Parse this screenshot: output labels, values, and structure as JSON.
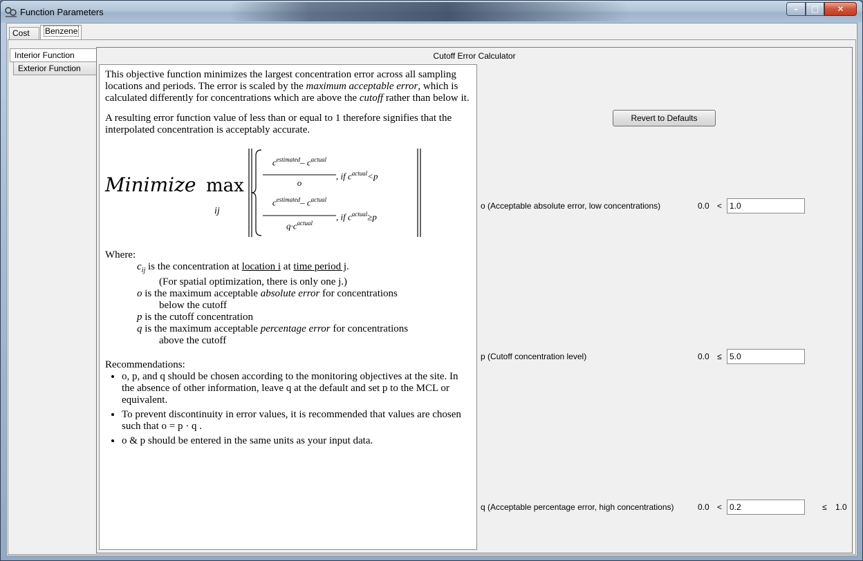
{
  "window": {
    "title": "Function Parameters"
  },
  "outer_tabs": {
    "cost": "Cost",
    "benzene": "Benzene"
  },
  "side_tabs": {
    "interior": "Interior Function",
    "exterior": "Exterior Function"
  },
  "panel": {
    "title": "Cutoff Error Calculator"
  },
  "description": {
    "p1_a": "This objective function minimizes the largest concentration error across all sampling locations and periods. The error is scaled by the ",
    "p1_b": "maximum acceptable error",
    "p1_c": ", which is calculated differently for concentrations which are above the ",
    "p1_d": "cutoff",
    "p1_e": " rather than below it.",
    "p2": "A resulting error function value of less than or equal to 1 therefore signifies that the interpolated concentration is acceptably accurate.",
    "formula": {
      "minimize": "Minimize",
      "max": "max",
      "ij": "ij",
      "num": "c",
      "sup_est": "estimated",
      "sup_act": "actual",
      "sub": "ij",
      "den1": "o",
      "den2": "q·c",
      "cond1": ", if c",
      "cond1_op": "<p",
      "cond2_op": "≥p"
    },
    "where": "Where:",
    "w1_a": "c",
    "w1_sub": "ij",
    "w1_b": " is the concentration at ",
    "w1_loc": "location i",
    "w1_c": " at ",
    "w1_time": "time period j",
    "w1_d": ".",
    "w1_note": "(For spatial optimization, there is only one j.)",
    "w2_a": "o",
    "w2_b": " is the maximum acceptable ",
    "w2_c": "absolute error",
    "w2_d": " for concentrations",
    "w2_note": "below the cutoff",
    "w3_a": "p",
    "w3_b": " is the cutoff concentration",
    "w4_a": "q",
    "w4_b": " is the maximum acceptable ",
    "w4_c": "percentage error",
    "w4_d": " for concentrations",
    "w4_note": "above the cutoff",
    "rec_title": "Recommendations:",
    "rec1": "o, p, and q should be chosen according to the monitoring objectives at the site.  In the absence of other information, leave q at the default and set p to the MCL or equivalent.",
    "rec2": "To prevent discontinuity in error values, it is recommended that values are chosen such that o = p · q .",
    "rec3": "o & p should be entered in the same units as your input data."
  },
  "controls": {
    "revert_label": "Revert to Defaults",
    "params": [
      {
        "label": "o (Acceptable absolute error, low concentrations)",
        "min": "0.0",
        "op": "<",
        "value": "1.0"
      },
      {
        "label": "p (Cutoff concentration level)",
        "min": "0.0",
        "op": "≤",
        "value": "5.0"
      },
      {
        "label": "q (Acceptable percentage error, high concentrations)",
        "min": "0.0",
        "op": "<",
        "value": "0.2",
        "op2": "≤",
        "max": "1.0"
      }
    ]
  }
}
